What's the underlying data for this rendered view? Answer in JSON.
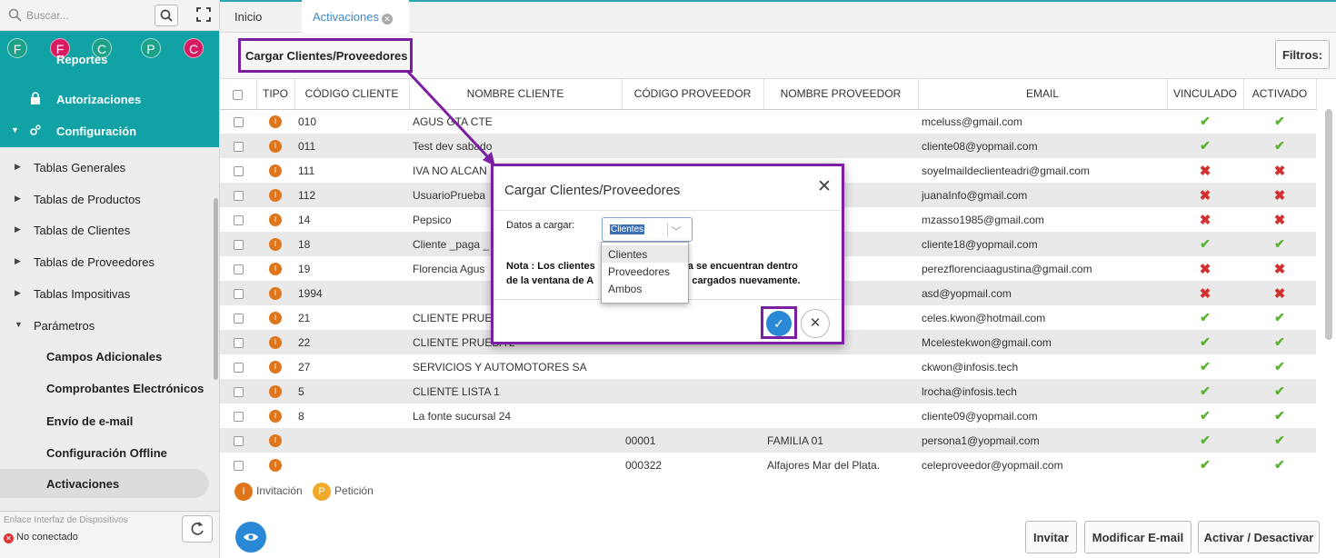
{
  "sidebar": {
    "search_placeholder": "Buscar...",
    "avatars": [
      {
        "letter": "F",
        "color": "#1aa187"
      },
      {
        "letter": "F",
        "color": "#d81b60"
      },
      {
        "letter": "C",
        "color": "#1aa187"
      },
      {
        "letter": "P",
        "color": "#1aa187"
      },
      {
        "letter": "C",
        "color": "#d81b60"
      }
    ],
    "reportes_partial": "Reportes",
    "autorizaciones": "Autorizaciones",
    "configuracion": "Configuración",
    "items": [
      "Tablas Generales",
      "Tablas de Productos",
      "Tablas de Clientes",
      "Tablas de Proveedores",
      "Tablas Impositivas",
      "Parámetros"
    ],
    "sub_items": [
      "Campos Adicionales",
      "Comprobantes Electrónicos",
      "Envío de e-mail",
      "Configuración Offline",
      "Activaciones"
    ],
    "status_link": "Enlace Interfaz de Dispositivos",
    "status_state": "No conectado"
  },
  "tabs": {
    "inicio": "Inicio",
    "activaciones": "Activaciones"
  },
  "toolbar": {
    "cargar": "Cargar Clientes/Proveedores",
    "filtros": "Filtros:"
  },
  "table": {
    "headers": [
      "TIPO",
      "CÓDIGO CLIENTE",
      "NOMBRE CLIENTE",
      "CÓDIGO PROVEEDOR",
      "NOMBRE PROVEEDOR",
      "EMAIL",
      "VINCULADO",
      "ACTIVADO"
    ],
    "rows": [
      {
        "codigo": "010",
        "nombre": "AGUS GTA CTE",
        "cprov": "",
        "nprov": "",
        "email": "mceluss@gmail.com",
        "vinc": true,
        "act": true
      },
      {
        "codigo": "011",
        "nombre": "Test dev sabado",
        "cprov": "",
        "nprov": "",
        "email": "cliente08@yopmail.com",
        "vinc": true,
        "act": true
      },
      {
        "codigo": "111",
        "nombre": "IVA NO ALCAN",
        "cprov": "",
        "nprov": "",
        "email": "soyelmaildeclienteadri@gmail.com",
        "vinc": false,
        "act": false
      },
      {
        "codigo": "112",
        "nombre": "UsuarioPrueba",
        "cprov": "",
        "nprov": "",
        "email": "juanaInfo@gmail.com",
        "vinc": false,
        "act": false
      },
      {
        "codigo": "14",
        "nombre": "Pepsico",
        "cprov": "",
        "nprov": "",
        "email": "mzasso1985@gmail.com",
        "vinc": false,
        "act": false
      },
      {
        "codigo": "18",
        "nombre": "Cliente _paga _",
        "cprov": "",
        "nprov": "",
        "email": "cliente18@yopmail.com",
        "vinc": true,
        "act": true
      },
      {
        "codigo": "19",
        "nombre": "Florencia Agus",
        "cprov": "",
        "nprov": "",
        "email": "perezflorenciaagustina@gmail.com",
        "vinc": false,
        "act": false
      },
      {
        "codigo": "1994",
        "nombre": "",
        "cprov": "",
        "nprov": "",
        "email": "asd@yopmail.com",
        "vinc": false,
        "act": false
      },
      {
        "codigo": "21",
        "nombre": "CLIENTE PRUE",
        "cprov": "",
        "nprov": "",
        "email": "celes.kwon@hotmail.com",
        "vinc": true,
        "act": true
      },
      {
        "codigo": "22",
        "nombre": "CLIENTE PRUEBA 2",
        "cprov": "",
        "nprov": "",
        "email": "Mcelestekwon@gmail.com",
        "vinc": true,
        "act": true
      },
      {
        "codigo": "27",
        "nombre": "SERVICIOS Y AUTOMOTORES SA",
        "cprov": "",
        "nprov": "",
        "email": "ckwon@infosis.tech",
        "vinc": true,
        "act": true
      },
      {
        "codigo": "5",
        "nombre": "CLIENTE LISTA 1",
        "cprov": "",
        "nprov": "",
        "email": "lrocha@infosis.tech",
        "vinc": true,
        "act": true
      },
      {
        "codigo": "8",
        "nombre": "La fonte sucursal 24",
        "cprov": "",
        "nprov": "",
        "email": "cliente09@yopmail.com",
        "vinc": true,
        "act": true
      },
      {
        "codigo": "",
        "nombre": "",
        "cprov": "00001",
        "nprov": "FAMILIA 01",
        "email": "persona1@yopmail.com",
        "vinc": true,
        "act": true
      },
      {
        "codigo": "",
        "nombre": "",
        "cprov": "000322",
        "nprov": "Alfajores Mar del Plata.",
        "email": "celeproveedor@yopmail.com",
        "vinc": true,
        "act": true
      }
    ]
  },
  "legend": {
    "invitacion": "Invitación",
    "peticion": "Petición",
    "inv_letter": "I",
    "pet_letter": "P"
  },
  "buttons": {
    "invitar": "Invitar",
    "modificar": "Modificar E-mail",
    "activar": "Activar / Desactivar"
  },
  "modal": {
    "title": "Cargar Clientes/Proveedores",
    "datos_label": "Datos a cargar:",
    "selected": "Clientes",
    "options": [
      "Clientes",
      "Proveedores",
      "Ambos"
    ],
    "nota_left_1": "Nota : Los clientes",
    "nota_right_1": "ue ya se encuentran dentro",
    "nota_left_2": "de la ventana de A",
    "nota_right_2": "rán cargados nuevamente."
  }
}
